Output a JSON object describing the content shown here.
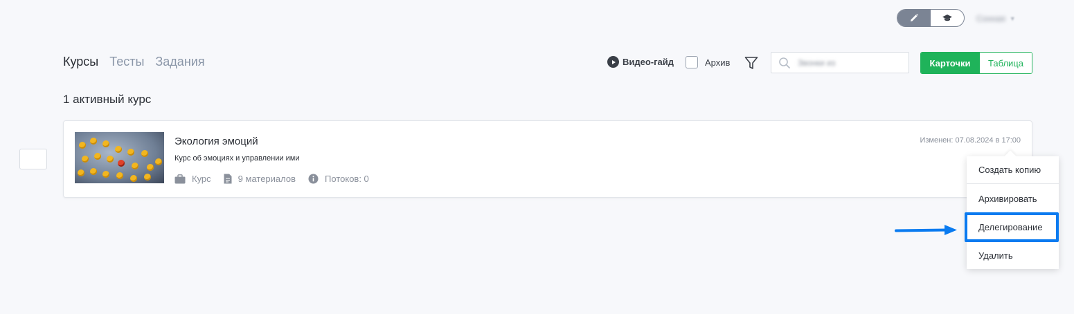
{
  "header": {
    "mode_toggle": {
      "edit_icon": "pencil-icon",
      "learn_icon": "graduation-cap-icon",
      "active": "edit"
    },
    "user_name": "Сонная",
    "user_menu_icon": "chevron-down-icon"
  },
  "tabs": [
    {
      "label": "Курсы",
      "active": true
    },
    {
      "label": "Тесты",
      "active": false
    },
    {
      "label": "Задания",
      "active": false
    }
  ],
  "toolbar": {
    "video_guide_label": "Видео-гайд",
    "archive_label": "Архив",
    "archive_checked": false,
    "filter_icon": "funnel-icon",
    "search_value": "Звонки из",
    "view_cards_label": "Карточки",
    "view_table_label": "Таблица",
    "active_view": "cards"
  },
  "count_heading": "1 активный курс",
  "course": {
    "title": "Экология эмоций",
    "description": "Курс об эмоциях и управлении ими",
    "modified": "Изменен: 07.08.2024 в 17:00",
    "type_label": "Курс",
    "materials_label": "9 материалов",
    "streams_label": "Потоков: 0"
  },
  "context_menu": {
    "items": [
      {
        "label": "Создать копию"
      },
      {
        "label": "Архивировать"
      },
      {
        "label": "Делегирование",
        "highlighted": true
      },
      {
        "label": "Удалить"
      }
    ]
  },
  "colors": {
    "accent_green": "#1fb35a",
    "highlight_blue": "#0a7bf0",
    "background": "#f7f8fb"
  }
}
